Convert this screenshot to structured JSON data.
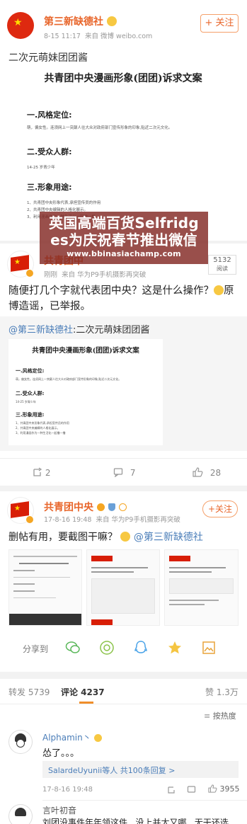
{
  "post1": {
    "author": "第三新缺德社",
    "time": "8-15 11:17",
    "source": "来自 微博 weibo.com",
    "follow": "+ 关注",
    "text": "二次元萌妹团团酱",
    "doc": {
      "title": "共青团中央漫画形象(团团)诉求文案",
      "sec1": "一.风格定位:",
      "sec1_line": "萌，偏女性。连须网上一突颠人往大众对政府部门宣传形象的印象,贴近二次元文化。",
      "sec2": "二.受众人群:",
      "sec2_line": "14-25 岁青少年",
      "sec3": "三.形象用途:",
      "sec3_lines": [
        "1、共青团中央形象代表,承担宣传员的作用",
        "2、共青团中央编辑的人格化展示。",
        "3、利用漫画作为一种生活化一起撸一撸"
      ]
    }
  },
  "overlay": {
    "line1": "英国高端百货Selfridg",
    "line2": "es为庆祝春节推出微信",
    "url": "www.bbinasiachamp.com"
  },
  "post2": {
    "author_partial": "共青团中",
    "time": "刚刚",
    "source": "来自 华为P9手机摄影再突破",
    "reads_num": "5132",
    "reads_label": "阅读",
    "text": "随便打几个字就代表团中央？这是什么操作？",
    "text_end": "原博造谣，已举报。",
    "repost_author": "@第三新缺德社",
    "repost_text": ":二次元萌妹团团酱",
    "doc": {
      "title": "共青团中央漫画形象(团团)诉求文案",
      "sec1": "一.风格定位:",
      "sec1_line": "萌，偏女性。连须网上一突颠人往大众对政府部门宣传形象的印象,贴近二次元文化。",
      "sec2": "二.受众人群:",
      "sec2_line": "14-25 岁青少年",
      "sec3": "三.形象用途:",
      "sec3_lines": [
        "1、共青团中央形象代表,承担宣传员的作用",
        "2、共青团中央编辑的人格化展示。",
        "3、利用漫画作为一种生活化一起撸一撸"
      ]
    },
    "actions": {
      "repost": "2",
      "comment": "7",
      "like": "28"
    }
  },
  "post3": {
    "author": "共青团中央",
    "time": "17-8-16 19:48",
    "source": "来自 华为P9手机摄影再突破",
    "follow": "+关注",
    "text": "删帖有用，要截图干嘛？",
    "mention": "@第三新缺德社",
    "share_label": "分享到"
  },
  "tabs": {
    "repost": "转发 5739",
    "comments": "评论 4237",
    "likes": "赞 1.3万",
    "sort": "按热度"
  },
  "comments": [
    {
      "name": "Alphamin丶",
      "text": "怂了。。。",
      "replies": "SalardeUyunii等人 共100条回复 >",
      "time": "17-8-16 19:48",
      "likes": "3955"
    },
    {
      "name": "言叶初音",
      "text": "刘团没事件年年领这件...没上并太又哪...无干还选"
    }
  ]
}
